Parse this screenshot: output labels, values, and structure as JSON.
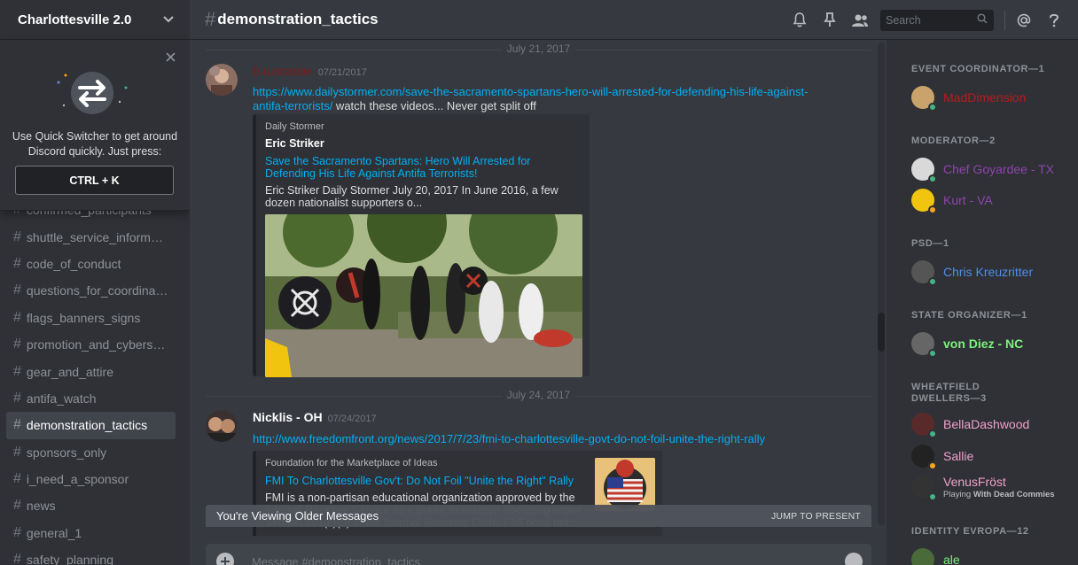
{
  "server": {
    "name": "Charlottesville 2.0"
  },
  "quick_switcher": {
    "text": "Use Quick Switcher to get around Discord quickly. Just press:",
    "shortcut": "CTRL + K"
  },
  "channels": [
    {
      "name": "confirmed_participants",
      "active": false
    },
    {
      "name": "shuttle_service_informat...",
      "active": false
    },
    {
      "name": "code_of_conduct",
      "active": false
    },
    {
      "name": "questions_for_coordinat...",
      "active": false
    },
    {
      "name": "flags_banners_signs",
      "active": false
    },
    {
      "name": "promotion_and_cyberstr...",
      "active": false
    },
    {
      "name": "gear_and_attire",
      "active": false
    },
    {
      "name": "antifa_watch",
      "active": false
    },
    {
      "name": "demonstration_tactics",
      "active": true
    },
    {
      "name": "sponsors_only",
      "active": false
    },
    {
      "name": "i_need_a_sponsor",
      "active": false
    },
    {
      "name": "news",
      "active": false
    },
    {
      "name": "general_1",
      "active": false
    },
    {
      "name": "safety_planning",
      "active": false
    }
  ],
  "header": {
    "channel": "demonstration_tactics",
    "search_placeholder": "Search"
  },
  "messages": {
    "dates": [
      "July 21, 2017",
      "July 24, 2017"
    ],
    "m1": {
      "author": "b-luccason",
      "author_color": "#7a1c1c",
      "timestamp": "07/21/2017",
      "link": "https://www.dailystormer.com/save-the-sacramento-spartans-hero-will-arrested-for-defending-his-life-against-antifa-terrorists/",
      "text": " watch these videos... Never get split off",
      "embed": {
        "provider": "Daily Stormer",
        "author": "Eric Striker",
        "title": "Save the Sacramento Spartans: Hero Will Arrested for Defending His Life Against Antifa Terrorists!",
        "description": "Eric Striker Daily Stormer July 20, 2017 In June 2016, a few dozen nationalist supporters o..."
      }
    },
    "m2": {
      "author": "Nicklis - OH",
      "author_color": "#ffffff",
      "timestamp": "07/24/2017",
      "link": "http://www.freedomfront.org/news/2017/7/23/fmi-to-charlottesville-govt-do-not-foil-unite-the-right-rally",
      "embed": {
        "provider": "Foundation for the Marketplace of Ideas",
        "title": "FMI To Charlottesville Gov't: Do Not Foil \"Unite the Right\" Rally",
        "description": "FMI is a non-partisan educational organization approved by the Internal Revenue Service as a public foundation operating under Section 501(c)(3) of the Internal Revenue Code. FMI does not"
      }
    },
    "older_banner": "You're Viewing Older Messages",
    "jump_label": "JUMP TO PRESENT"
  },
  "composer": {
    "placeholder": "Message #demonstration_tactics"
  },
  "members": {
    "roles": [
      {
        "title": "EVENT COORDINATOR—1"
      },
      {
        "title": "MODERATOR—2"
      },
      {
        "title": "PSD—1"
      },
      {
        "title": "STATE ORGANIZER—1"
      },
      {
        "title": "WHEATFIELD DWELLERS—3"
      },
      {
        "title": "IDENTITY EVROPA—12"
      }
    ],
    "list": [
      {
        "name": "MadDimension",
        "color": "#b71c1c",
        "status": "online",
        "avatar": "#c9a36b"
      },
      {
        "name": "Chef Goyardee - TX",
        "color": "#8e44ad",
        "status": "online",
        "avatar": "#d9d9d9"
      },
      {
        "name": "Kurt - VA",
        "color": "#8e44ad",
        "status": "idle",
        "avatar": "#f1c40f"
      },
      {
        "name": "Chris Kreuzritter",
        "color": "#4f8ee8",
        "status": "online",
        "avatar": "#555555"
      },
      {
        "name": "von Diez - NC",
        "color": "#7cf27c",
        "status": "online",
        "avatar": "#666666"
      },
      {
        "name": "BellaDashwood",
        "color": "#f0a0c8",
        "status": "online",
        "avatar": "#5a2a2a"
      },
      {
        "name": "Sallie",
        "color": "#f0a0c8",
        "status": "idle",
        "avatar": "#222222"
      },
      {
        "name": "VenusFröst",
        "color": "#f0a0c8",
        "status": "online",
        "avatar": "#333333",
        "activity_prefix": "Playing",
        "activity_game": "With Dead Commies"
      },
      {
        "name": "ale",
        "color": "#7cf27c",
        "status": "online",
        "avatar": "#4a6a3a"
      }
    ],
    "status_colors": {
      "online": "#43b581",
      "idle": "#faa61a"
    }
  }
}
